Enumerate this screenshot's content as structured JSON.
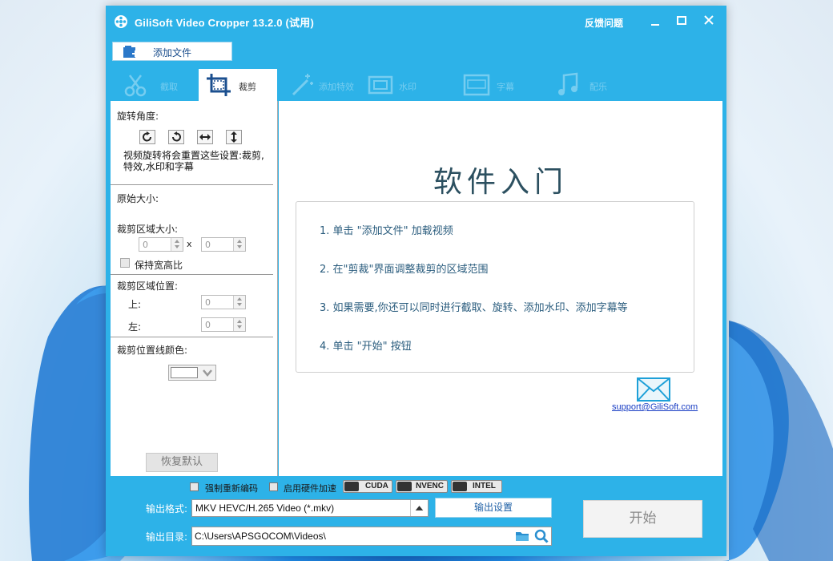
{
  "window": {
    "title": "GiliSoft Video Cropper 13.2.0 (试用)",
    "feedback": "反馈问题"
  },
  "toolbar": {
    "add_file": "添加文件"
  },
  "tabs": [
    {
      "label": "截取",
      "icon": "scissors-icon",
      "active": false
    },
    {
      "label": "裁剪",
      "icon": "crop-icon",
      "active": true
    },
    {
      "label": "添加特效",
      "icon": "magic-wand-icon",
      "active": false
    },
    {
      "label": "水印",
      "icon": "watermark-icon",
      "active": false
    },
    {
      "label": "字幕",
      "icon": "subtitle-icon",
      "active": false
    },
    {
      "label": "配乐",
      "icon": "music-note-icon",
      "active": false
    }
  ],
  "left": {
    "rotate_label": "旋转角度:",
    "rotate_note": "视频旋转将会重置这些设置:裁剪,特效,水印和字幕",
    "original_size_label": "原始大小:",
    "crop_size_label": "裁剪区域大小:",
    "crop_width": "0",
    "crop_height": "0",
    "times": "x",
    "keep_ratio": "保持宽高比",
    "crop_pos_label": "裁剪区域位置:",
    "top_label": "上:",
    "top_value": "0",
    "left_label": "左:",
    "left_value": "0",
    "line_color_label": "裁剪位置线颜色:",
    "line_color": "#ffffff",
    "reset": "恢复默认"
  },
  "content": {
    "title": "软件入门",
    "steps": [
      "1. 单击 \"添加文件\" 加载视频",
      "2. 在\"剪裁\"界面调整裁剪的区域范围",
      "3. 如果需要,你还可以同时进行截取、旋转、添加水印、添加字幕等",
      "4. 单击 \"开始\" 按钮"
    ],
    "support_email": "support@GiliSoft.com"
  },
  "bottom": {
    "force_reencode": "强制重新编码",
    "hw_accel": "启用硬件加速",
    "cuda": "CUDA",
    "nvenc": "NVENC",
    "intel": "INTEL",
    "format_label": "输出格式:",
    "format_value": "MKV HEVC/H.265 Video (*.mkv)",
    "output_settings": "输出设置",
    "dir_label": "输出目录:",
    "dir_value": "C:\\Users\\APSGOCOM\\Videos\\",
    "start": "开始"
  },
  "colors": {
    "window_bg": "#2db2e8",
    "title_text": "#ffffff",
    "step_text": "#2b5d7e",
    "link": "#1a3ec4"
  }
}
